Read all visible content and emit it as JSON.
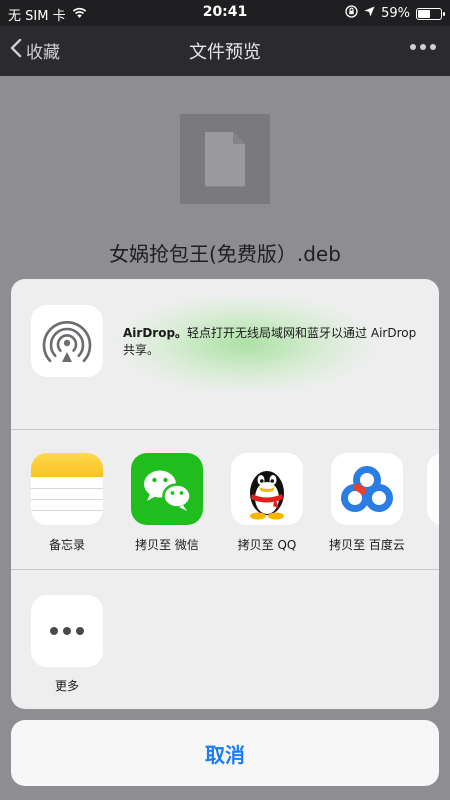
{
  "status_bar": {
    "carrier": "无 SIM 卡",
    "time": "20:41",
    "battery_percent": "59%",
    "battery_level": 0.59,
    "wifi_icon": "wifi-icon",
    "lock_icon": "orientation-lock-icon",
    "location_icon": "location-arrow-icon"
  },
  "nav": {
    "back_label": "收藏",
    "title": "文件预览"
  },
  "preview": {
    "file_name": "女娲抢包王(免费版）.deb"
  },
  "share_sheet": {
    "airdrop": {
      "title": "AirDrop。",
      "description": "轻点打开无线局域网和蓝牙以通过 AirDrop 共享。"
    },
    "apps": [
      {
        "label": "备忘录",
        "icon": "notes-icon"
      },
      {
        "label": "拷贝至 微信",
        "icon": "wechat-icon"
      },
      {
        "label": "拷贝至 QQ",
        "icon": "qq-icon"
      },
      {
        "label": "拷贝至 百度云",
        "icon": "baidu-cloud-icon"
      }
    ],
    "more_label": "更多"
  },
  "cancel_label": "取消",
  "colors": {
    "accent": "#1a7cf5",
    "wechat_green": "#1fbd1e",
    "nav_bg": "#2b2b2e"
  }
}
